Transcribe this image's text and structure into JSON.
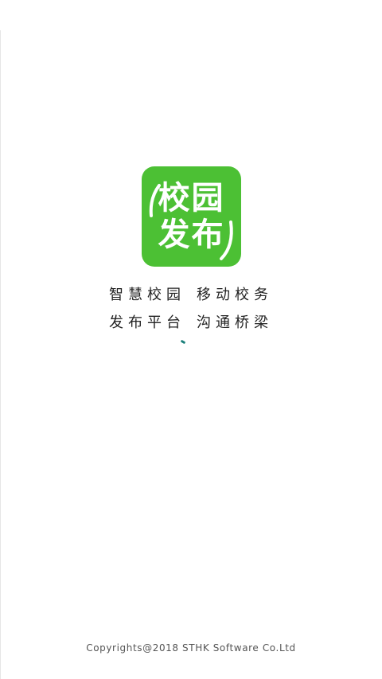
{
  "logo": {
    "line1": "校园",
    "line2": "发布",
    "color": "#4cc034"
  },
  "slogan": {
    "line1_left": "智慧校园",
    "line1_right": "移动校务",
    "line2_left": "发布平台",
    "line2_right": "沟通桥梁"
  },
  "loading": {
    "icon": "spinner-icon",
    "color": "#1a7f7a"
  },
  "footer": {
    "copyright": "Copyrights@2018 STHK Software Co.Ltd"
  }
}
